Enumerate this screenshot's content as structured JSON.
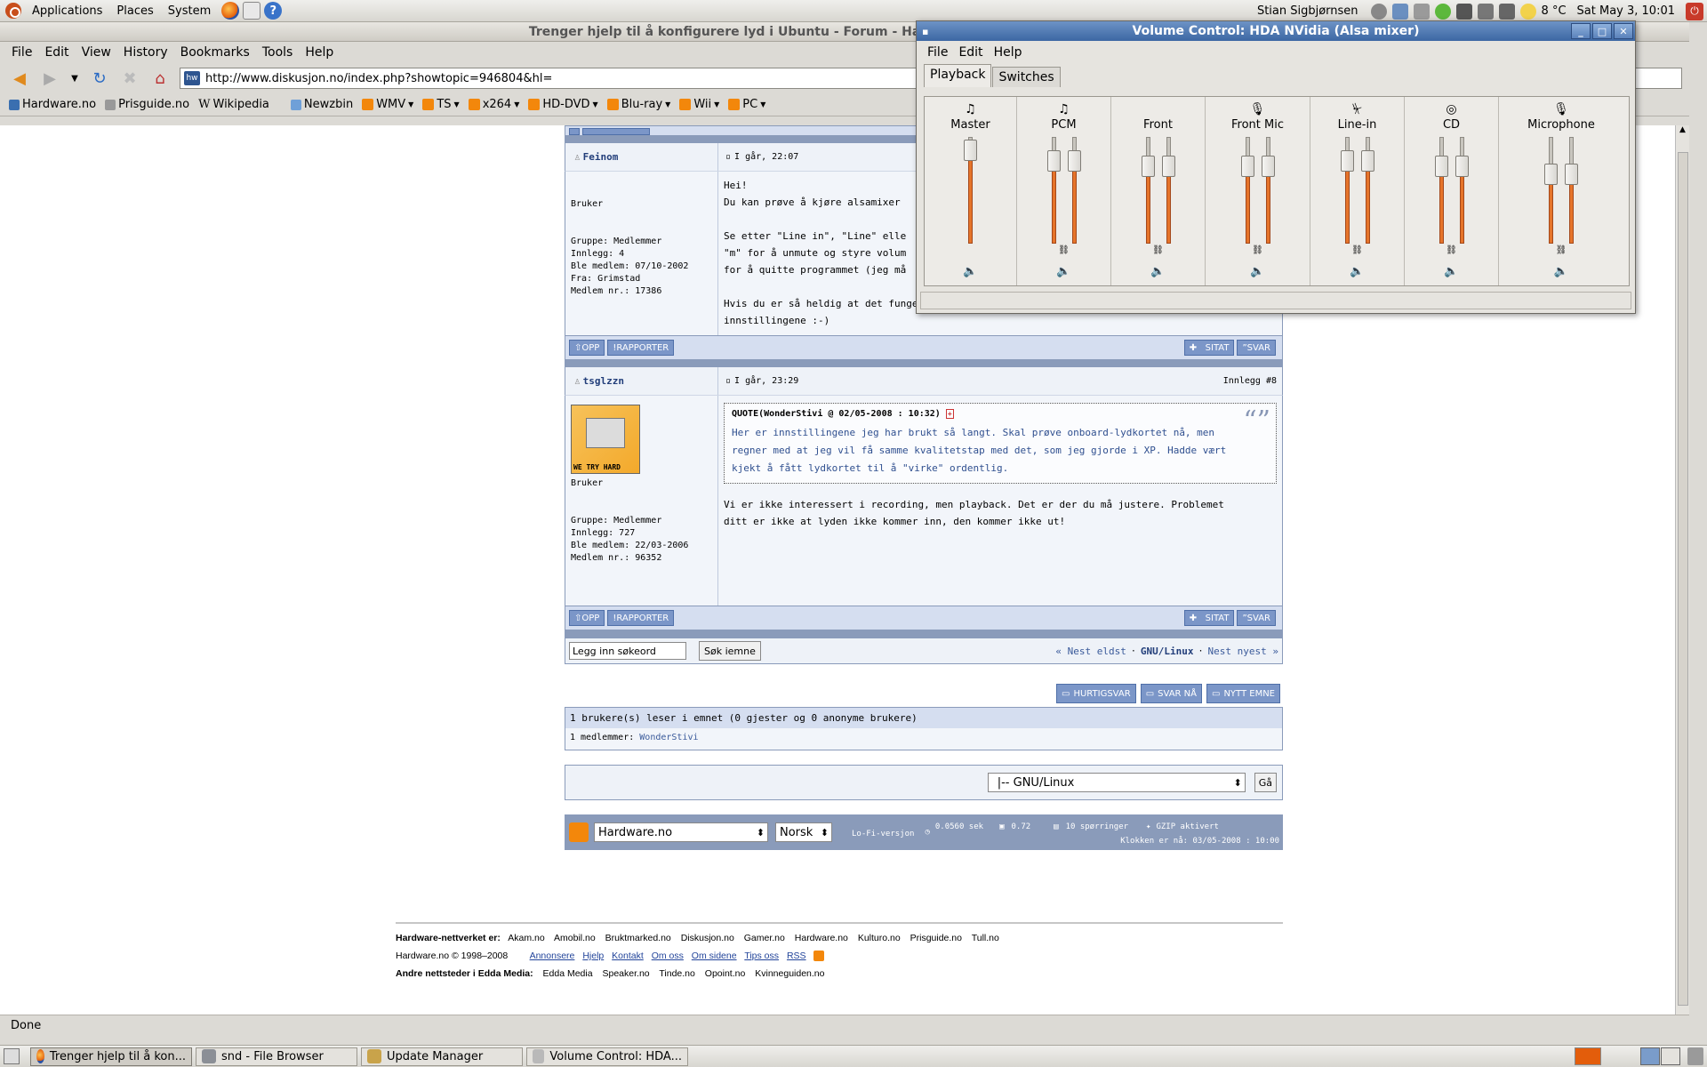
{
  "top_panel": {
    "menus": [
      "Applications",
      "Places",
      "System"
    ],
    "user": "Stian Sigbjørnsen",
    "weather": "8 °C",
    "clock": "Sat May  3, 10:01"
  },
  "firefox": {
    "title": "Trenger hjelp til å konfigurere lyd i Ubuntu - Forum - Hardw",
    "menu": [
      "File",
      "Edit",
      "View",
      "History",
      "Bookmarks",
      "Tools",
      "Help"
    ],
    "url": "http://www.diskusjon.no/index.php?showtopic=946804&hl=",
    "bookmarks": [
      "Hardware.no",
      "Prisguide.no",
      "Wikipedia",
      "Newzbin",
      "WMV",
      "TS",
      "x264",
      "HD-DVD",
      "Blu-ray",
      "Wii",
      "PC"
    ],
    "status": "Done"
  },
  "forum": {
    "btn_opp": "OPP",
    "btn_rapporter": "RAPPORTER",
    "btn_sitat": "SITAT",
    "btn_svar": "SVAR",
    "post1": {
      "name": "Feinom",
      "date": "I går, 22:07",
      "rank": "Bruker",
      "meta": [
        "Gruppe: Medlemmer",
        "Innlegg: 4",
        "Ble medlem: 07/10-2002",
        "Fra: Grimstad",
        "Medlem nr.: 17386"
      ],
      "lines": [
        "Hei!",
        "Du kan prøve å kjøre alsamixer",
        "",
        "Se etter \"Line in\", \"Line\" elle",
        "\"m\" for å unmute og styre volum",
        "for å quitte programmet (jeg må",
        "",
        "Hvis du er så heldig at det fungerer, kan du skrive \"alsactl store\" for å lagre",
        "innstillingene :-)"
      ]
    },
    "post2": {
      "name": "tsglzzn",
      "date": "I går, 23:29",
      "num": "Innlegg #8",
      "rank": "Bruker",
      "avatar_text": "WE TRY HARD",
      "meta": [
        "Gruppe: Medlemmer",
        "Innlegg: 727",
        "Ble medlem: 22/03-2006",
        "Medlem nr.: 96352"
      ],
      "quote_head": "QUOTE(WonderStivi @ 02/05-2008 : 10:32)",
      "quote_lines": [
        "Her er innstillingene jeg har brukt så langt. Skal prøve onboard-lydkortet nå, men",
        "regner med at jeg vil få samme kvalitetstap med det, som jeg gjorde i XP. Hadde vært",
        "kjekt å fått lydkortet til å \"virke\" ordentlig."
      ],
      "lines": [
        "Vi er ikke interessert i recording, men playback. Det er der du må justere. Problemet",
        "ditt er ikke at lyden ikke kommer inn, den kommer ikke ut!"
      ]
    },
    "search_placeholder": "Legg inn søkeord",
    "search_button": "Søk iemne",
    "nav": {
      "prev": "« Nest eldst",
      "sep": "·",
      "forum": "GNU/Linux",
      "next": "Nest nyest »"
    },
    "actions": [
      "HURTIGSVAR",
      "SVAR NÅ",
      "NYTT EMNE"
    ],
    "readers_head": "1 brukere(s) leser i emnet (0 gjester og 0 anonyme brukere)",
    "readers_members": "1 medlemmer:",
    "readers_name": "WonderStivi",
    "jump_select": "|-- GNU/Linux",
    "jump_button": "Gå",
    "footer": {
      "site_select": "Hardware.no",
      "lang_select": "Norsk",
      "lofi": "Lo-Fi-versjon",
      "time": "0.0560 sek",
      "load": "0.72",
      "queries": "10 spørringer",
      "gzip": "GZIP aktivert",
      "clock": "Klokken er nå: 03/05-2008 : 10:00"
    },
    "network_label": "Hardware-nettverket er:",
    "network_sites": [
      "Akam.no",
      "Amobil.no",
      "Bruktmarked.no",
      "Diskusjon.no",
      "Gamer.no",
      "Hardware.no",
      "Kulturo.no",
      "Prisguide.no",
      "Tull.no"
    ],
    "copyright": "Hardware.no © 1998–2008",
    "footer_links": [
      "Annonsere",
      "Hjelp",
      "Kontakt",
      "Om oss",
      "Om sidene",
      "Tips oss",
      "RSS"
    ],
    "edda_label": "Andre nettsteder i Edda Media:",
    "edda_sites": [
      "Edda Media",
      "Speaker.no",
      "Tinde.no",
      "Opoint.no",
      "Kvinneguiden.no"
    ]
  },
  "volume": {
    "title": "Volume Control: HDA NVidia (Alsa mixer)",
    "menu": [
      "File",
      "Edit",
      "Help"
    ],
    "tabs": [
      "Playback",
      "Switches"
    ],
    "channels": [
      {
        "name": "Master",
        "icon": "music-note-icon",
        "levels": [
          0.95
        ]
      },
      {
        "name": "PCM",
        "icon": "music-note-icon",
        "levels": [
          0.85,
          0.85
        ]
      },
      {
        "name": "Front",
        "icon": "speaker-icon",
        "levels": [
          0.8,
          0.8
        ]
      },
      {
        "name": "Front Mic",
        "icon": "microphone-icon",
        "levels": [
          0.8,
          0.8
        ]
      },
      {
        "name": "Line-in",
        "icon": "line-in-icon",
        "levels": [
          0.85,
          0.85
        ]
      },
      {
        "name": "CD",
        "icon": "cd-icon",
        "levels": [
          0.8,
          0.8
        ]
      },
      {
        "name": "Microphone",
        "icon": "microphone-icon",
        "levels": [
          0.72,
          0.72
        ]
      }
    ]
  },
  "taskbar": [
    "Trenger hjelp til å kon...",
    "snd - File Browser",
    "Update Manager",
    "Volume Control: HDA..."
  ]
}
